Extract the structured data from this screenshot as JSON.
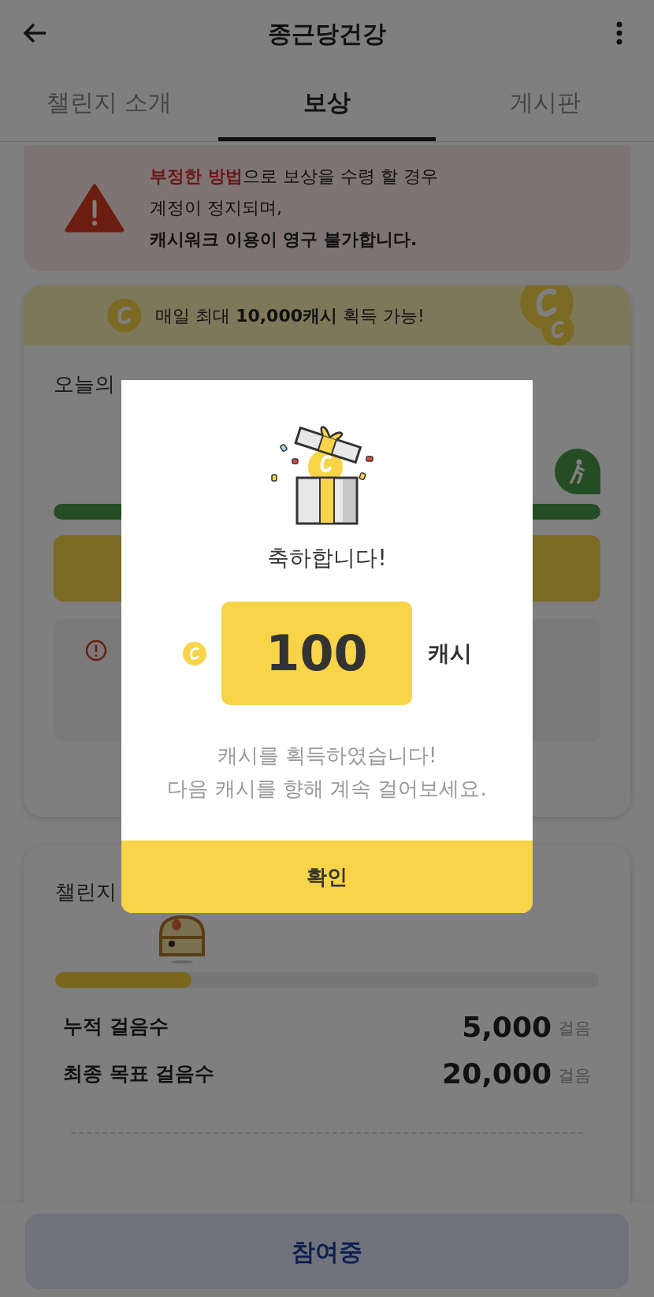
{
  "header": {
    "title": "종근당건강"
  },
  "tabs": [
    {
      "label": "챌린지 소개",
      "selected": false
    },
    {
      "label": "보상",
      "selected": true
    },
    {
      "label": "게시판",
      "selected": false
    }
  ],
  "warning": {
    "lines": [
      {
        "text": "**부정한 방법**으로 보상을 수령 할 경우",
        "bold": false
      },
      {
        "text": "계정이 정지되며,",
        "bold": false
      },
      {
        "text": "캐시워크 이용이 영구 불가합니다.",
        "bold": true
      }
    ]
  },
  "daily_banner": {
    "text": "매일 최대 **10,000캐시** 획득 가능!"
  },
  "today_card": {
    "title": "오늘의",
    "level": 1
  },
  "challenge_card": {
    "title": "챌린지",
    "level": 0.25,
    "stats": [
      {
        "label": "누적 걸음수",
        "value": "5,000",
        "unit": "걸음"
      },
      {
        "label": "최종 목표 걸음수",
        "value": "20,000",
        "unit": "걸음"
      }
    ]
  },
  "bottom_button": {
    "label": "참여중"
  },
  "modal": {
    "title": "축하합니다!",
    "amount": "100",
    "unit": "캐시",
    "message": [
      "캐시를 획득하였습니다!",
      "다음 캐시를 향해 계속 걸어보세요."
    ],
    "confirm": "확인"
  }
}
